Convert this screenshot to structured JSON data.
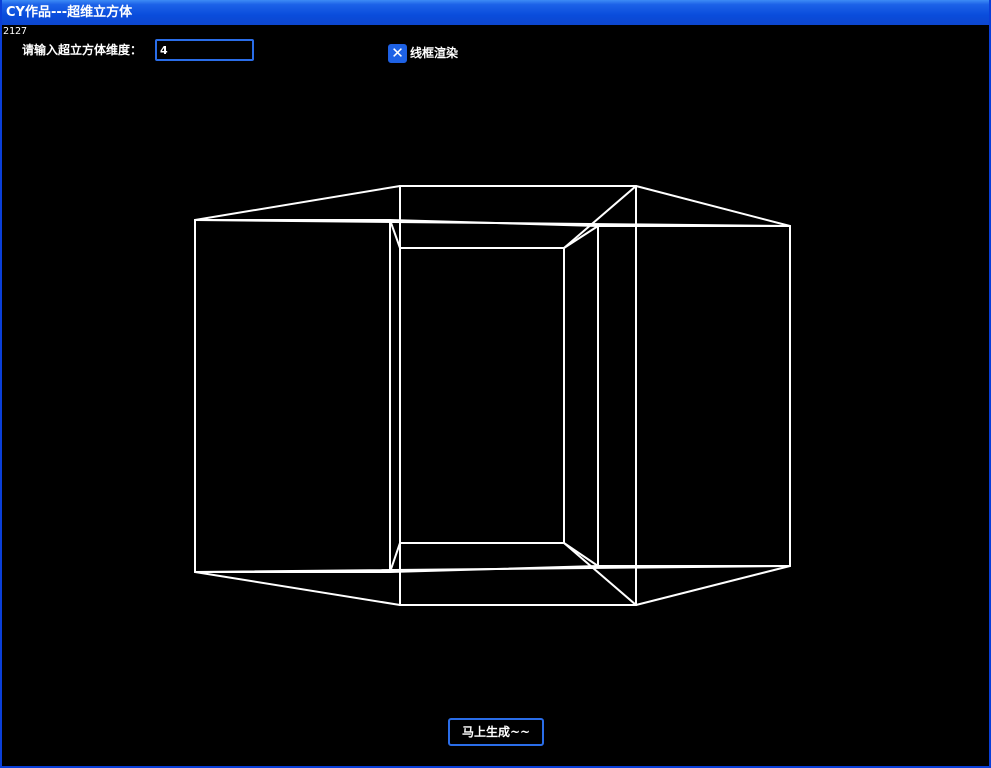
{
  "window": {
    "title": "CY作品---超维立方体"
  },
  "status": {
    "counter": "2127"
  },
  "controls": {
    "dimension_label": "请输入超立方体维度：",
    "dimension_value": "4",
    "wireframe_checked": true,
    "wireframe_check_glyph": "✕",
    "wireframe_label": "线框渲染",
    "generate_button": "马上生成~~"
  },
  "render": {
    "line_color": "#ffffff",
    "background": "#000000"
  }
}
